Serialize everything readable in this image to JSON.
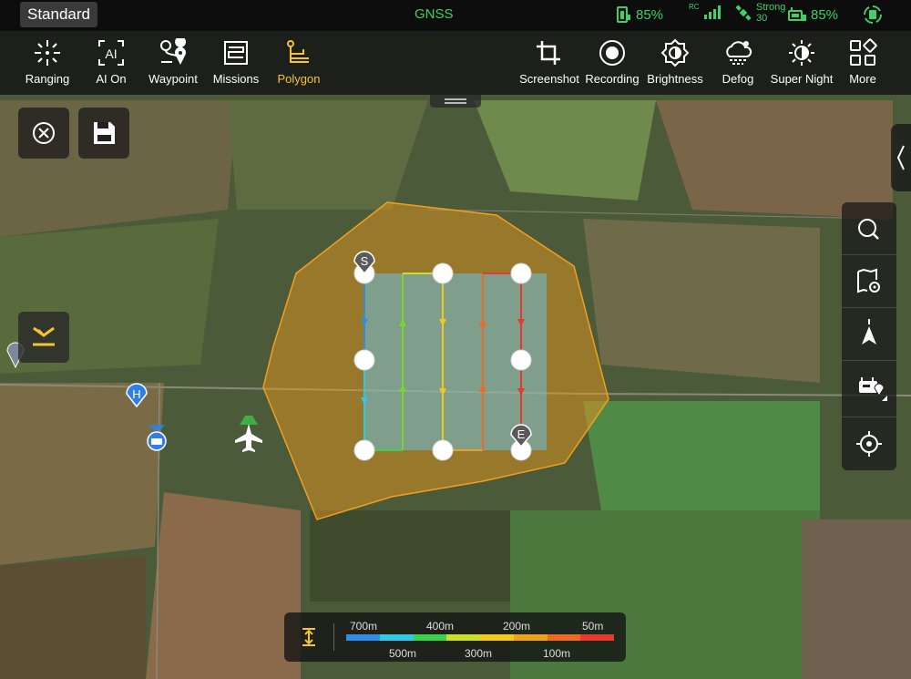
{
  "status": {
    "mode": "Standard",
    "gnss": "GNSS",
    "aircraft_battery": "85%",
    "rc_label": "RC",
    "signal_text": "Strong",
    "satellites": "30",
    "rc_battery": "85%"
  },
  "toolbar_left": [
    {
      "label": "Ranging",
      "icon": "ranging-icon"
    },
    {
      "label": "AI On",
      "icon": "ai-icon"
    },
    {
      "label": "Waypoint",
      "icon": "waypoint-icon"
    },
    {
      "label": "Missions",
      "icon": "missions-icon"
    },
    {
      "label": "Polygon",
      "icon": "polygon-icon",
      "active": true
    }
  ],
  "toolbar_right": [
    {
      "label": "Screenshot",
      "icon": "screenshot-icon"
    },
    {
      "label": "Recording",
      "icon": "record-icon"
    },
    {
      "label": "Brightness",
      "icon": "brightness-icon"
    },
    {
      "label": "Defog",
      "icon": "defog-icon"
    },
    {
      "label": "Super Night",
      "icon": "super-night-icon"
    },
    {
      "label": "More",
      "icon": "more-icon"
    }
  ],
  "map": {
    "start_marker": "S",
    "end_marker": "E",
    "home_marker": "H"
  },
  "legend": {
    "top_labels": [
      "700m",
      "400m",
      "200m",
      "50m"
    ],
    "bottom_labels": [
      "500m",
      "300m",
      "100m"
    ],
    "colors": [
      "#2f8fe8",
      "#33c6e6",
      "#3ad24a",
      "#c8e02a",
      "#f2c81e",
      "#f0a020",
      "#ee6a22",
      "#e83a2a"
    ]
  },
  "colors": {
    "accent": "#f4c531",
    "status_green": "#3fd06a",
    "polygon": "#f0a020"
  }
}
